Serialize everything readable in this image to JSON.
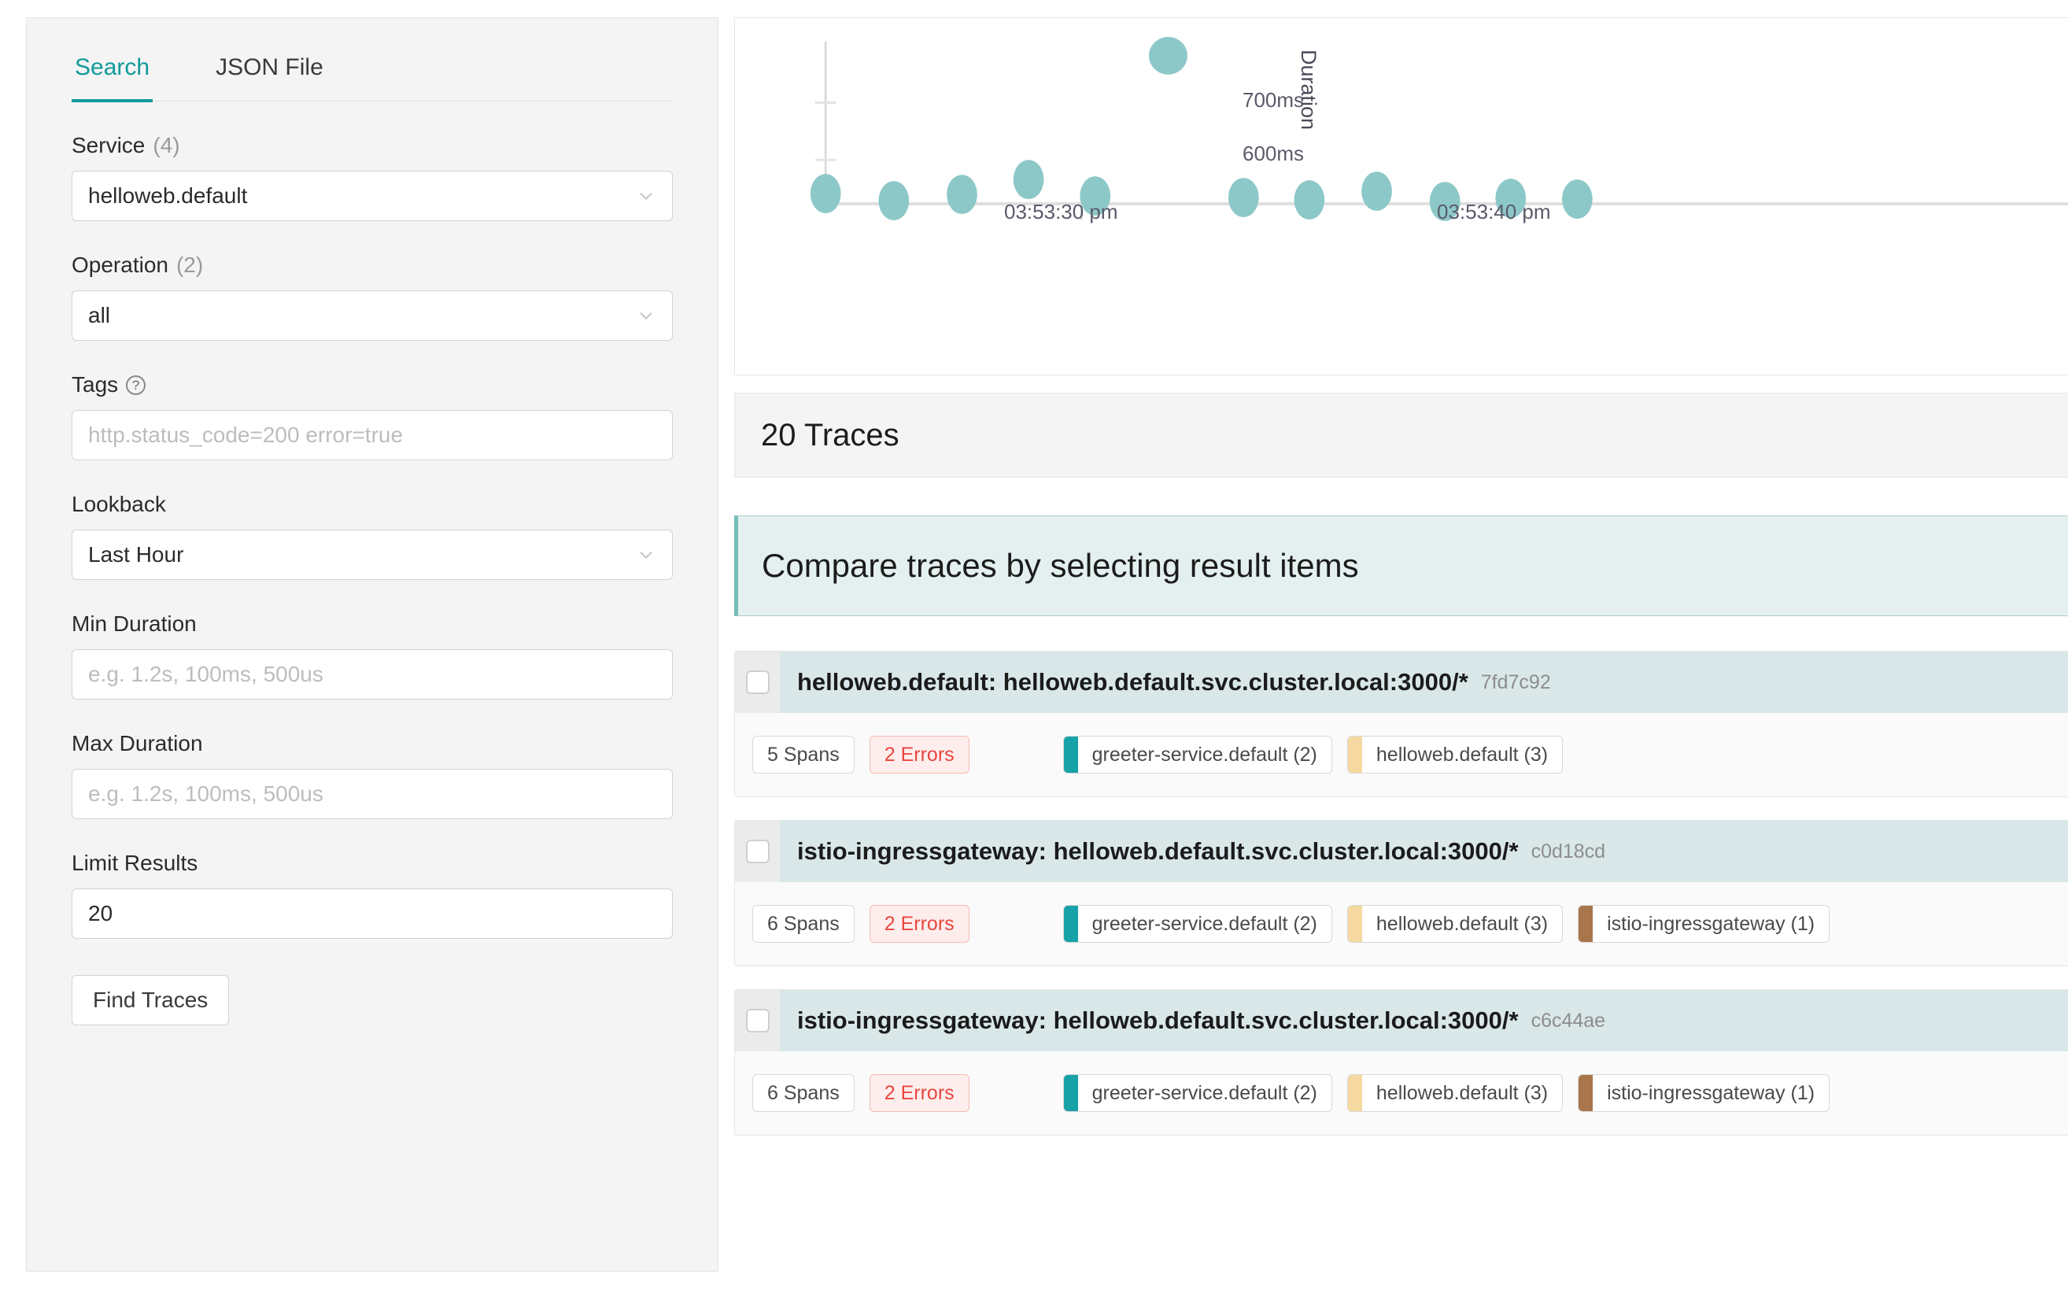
{
  "sidebar": {
    "tabs": [
      {
        "label": "Search",
        "active": true
      },
      {
        "label": "JSON File",
        "active": false
      }
    ],
    "fields": {
      "service": {
        "label": "Service",
        "count": "(4)",
        "value": "helloweb.default",
        "icon": "chevron-down-icon"
      },
      "operation": {
        "label": "Operation",
        "count": "(2)",
        "value": "all",
        "icon": "chevron-down-icon"
      },
      "tags": {
        "label": "Tags",
        "help_icon": "?",
        "value": "",
        "placeholder": "http.status_code=200 error=true"
      },
      "lookback": {
        "label": "Lookback",
        "value": "Last Hour",
        "icon": "chevron-down-icon"
      },
      "min_duration": {
        "label": "Min Duration",
        "value": "",
        "placeholder": "e.g. 1.2s, 100ms, 500us"
      },
      "max_duration": {
        "label": "Max Duration",
        "value": "",
        "placeholder": "e.g. 1.2s, 100ms, 500us"
      },
      "limit_results": {
        "label": "Limit Results",
        "value": "20",
        "placeholder": ""
      }
    },
    "find_button": "Find Traces"
  },
  "main": {
    "traces_header": "20 Traces",
    "compare_banner": "Compare traces by selecting result items",
    "results": [
      {
        "service": "helloweb.default",
        "operation": "helloweb.default.svc.cluster.local:3000/*",
        "title": "helloweb.default: helloweb.default.svc.cluster.local:3000/*",
        "trace_id": "7fd7c92",
        "spans": "5 Spans",
        "errors": "2 Errors",
        "services": [
          {
            "name": "greeter-service.default (2)",
            "color": "#17a2a8"
          },
          {
            "name": "helloweb.default (3)",
            "color": "#f5d9a0"
          }
        ]
      },
      {
        "service": "istio-ingressgateway",
        "operation": "helloweb.default.svc.cluster.local:3000/*",
        "title": "istio-ingressgateway: helloweb.default.svc.cluster.local:3000/*",
        "trace_id": "c0d18cd",
        "spans": "6 Spans",
        "errors": "2 Errors",
        "services": [
          {
            "name": "greeter-service.default (2)",
            "color": "#17a2a8"
          },
          {
            "name": "helloweb.default (3)",
            "color": "#f5d9a0"
          },
          {
            "name": "istio-ingressgateway (1)",
            "color": "#a9754b"
          }
        ]
      },
      {
        "service": "istio-ingressgateway",
        "operation": "helloweb.default.svc.cluster.local:3000/*",
        "title": "istio-ingressgateway: helloweb.default.svc.cluster.local:3000/*",
        "trace_id": "c6c44ae",
        "spans": "6 Spans",
        "errors": "2 Errors",
        "services": [
          {
            "name": "greeter-service.default (2)",
            "color": "#17a2a8"
          },
          {
            "name": "helloweb.default (3)",
            "color": "#f5d9a0"
          },
          {
            "name": "istio-ingressgateway (1)",
            "color": "#a9754b"
          }
        ]
      }
    ]
  },
  "chart_data": {
    "type": "scatter",
    "title": "",
    "xlabel": "",
    "ylabel": "Duration",
    "y_ticks": [
      "600ms",
      "700ms"
    ],
    "y_tick_values": [
      600,
      700
    ],
    "x_ticks": [
      "03:53:30 pm",
      "03:53:40 pm"
    ],
    "grid": false,
    "legend": null,
    "point_color": "#8dc8c8",
    "ylim": [
      500,
      780
    ],
    "points": [
      {
        "x": "03:53:27 pm",
        "y": 512
      },
      {
        "x": "03:53:28 pm",
        "y": 505
      },
      {
        "x": "03:53:29 pm",
        "y": 518
      },
      {
        "x": "03:53:29.6 pm",
        "y": 532
      },
      {
        "x": "03:53:30 pm",
        "y": 510
      },
      {
        "x": "03:53:32 pm",
        "y": 760
      },
      {
        "x": "03:53:35 pm",
        "y": 513
      },
      {
        "x": "03:53:36 pm",
        "y": 510
      },
      {
        "x": "03:53:37 pm",
        "y": 525
      },
      {
        "x": "03:53:39 pm",
        "y": 508
      },
      {
        "x": "03:53:40 pm",
        "y": 512
      },
      {
        "x": "03:53:41 pm",
        "y": 512
      }
    ]
  },
  "colors": {
    "accent_teal": "#199",
    "point_teal": "#8dc8c8",
    "banner_bg": "#e4f0ef",
    "row_header_bg": "#d9e7e8",
    "error_red": "#e8473f"
  }
}
